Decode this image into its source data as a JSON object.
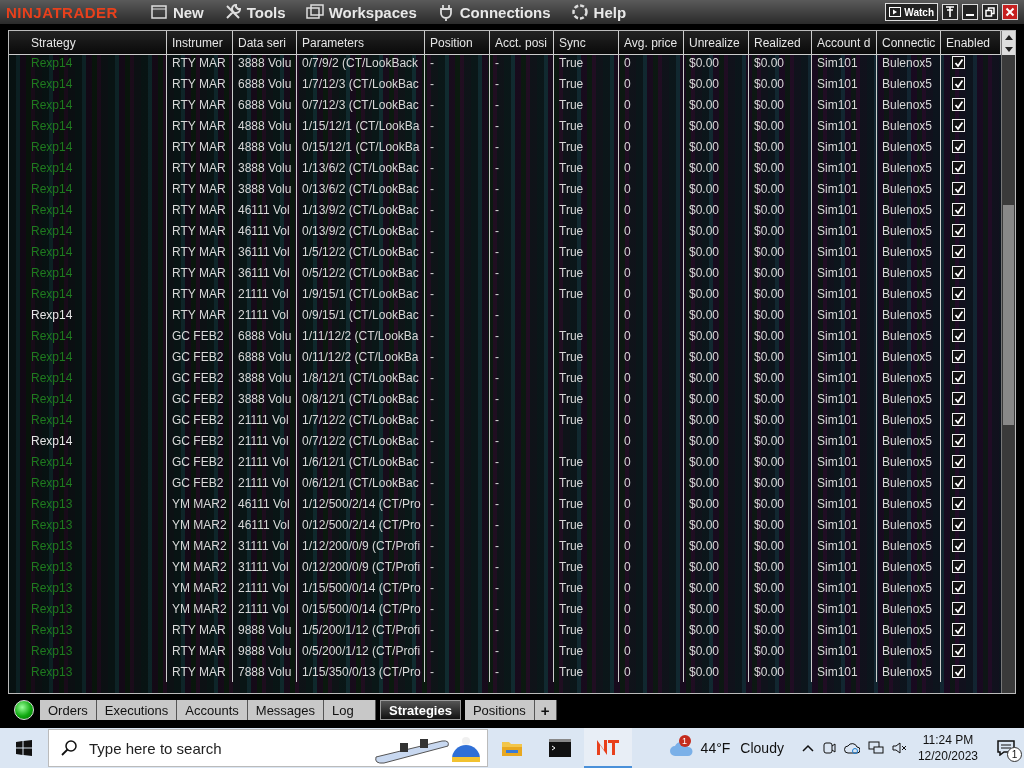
{
  "title_bar": {
    "logo": "NINJATRADER",
    "menu": [
      "New",
      "Tools",
      "Workspaces",
      "Connections",
      "Help"
    ],
    "watch_button": "Watch"
  },
  "table": {
    "columns": [
      "Strategy",
      "Instrumer",
      "Data seri",
      "Parameters",
      "Position",
      "Acct. posi",
      "Sync",
      "Avg. price",
      "Unrealize",
      "Realized",
      "Account d",
      "Connectic",
      "Enabled"
    ],
    "rows": [
      {
        "strategy": "Rexp14",
        "color": "#1f7a1f",
        "instrument": "RTY MAR",
        "data_series": "3888 Volu",
        "parameters": "0/7/9/2 (CT/LookBack",
        "position": "-",
        "acct_position": "-",
        "sync": "True",
        "avg_price": "0",
        "unrealized": "$0.00",
        "realized": "$0.00",
        "account": "Sim101",
        "connection": "Bulenox5",
        "enabled": true
      },
      {
        "strategy": "Rexp14",
        "color": "#1f7a1f",
        "instrument": "RTY MAR",
        "data_series": "6888 Volu",
        "parameters": "1/7/12/3 (CT/LookBac",
        "position": "-",
        "acct_position": "-",
        "sync": "True",
        "avg_price": "0",
        "unrealized": "$0.00",
        "realized": "$0.00",
        "account": "Sim101",
        "connection": "Bulenox5",
        "enabled": true
      },
      {
        "strategy": "Rexp14",
        "color": "#1f7a1f",
        "instrument": "RTY MAR",
        "data_series": "6888 Volu",
        "parameters": "0/7/12/3 (CT/LookBac",
        "position": "-",
        "acct_position": "-",
        "sync": "True",
        "avg_price": "0",
        "unrealized": "$0.00",
        "realized": "$0.00",
        "account": "Sim101",
        "connection": "Bulenox5",
        "enabled": true
      },
      {
        "strategy": "Rexp14",
        "color": "#1f7a1f",
        "instrument": "RTY MAR",
        "data_series": "4888 Volu",
        "parameters": "1/15/12/1 (CT/LookBa",
        "position": "-",
        "acct_position": "-",
        "sync": "True",
        "avg_price": "0",
        "unrealized": "$0.00",
        "realized": "$0.00",
        "account": "Sim101",
        "connection": "Bulenox5",
        "enabled": true
      },
      {
        "strategy": "Rexp14",
        "color": "#1f7a1f",
        "instrument": "RTY MAR",
        "data_series": "4888 Volu",
        "parameters": "0/15/12/1 (CT/LookBa",
        "position": "-",
        "acct_position": "-",
        "sync": "True",
        "avg_price": "0",
        "unrealized": "$0.00",
        "realized": "$0.00",
        "account": "Sim101",
        "connection": "Bulenox5",
        "enabled": true
      },
      {
        "strategy": "Rexp14",
        "color": "#1f7a1f",
        "instrument": "RTY MAR",
        "data_series": "3888 Volu",
        "parameters": "1/13/6/2 (CT/LookBac",
        "position": "-",
        "acct_position": "-",
        "sync": "True",
        "avg_price": "0",
        "unrealized": "$0.00",
        "realized": "$0.00",
        "account": "Sim101",
        "connection": "Bulenox5",
        "enabled": true
      },
      {
        "strategy": "Rexp14",
        "color": "#1f7a1f",
        "instrument": "RTY MAR",
        "data_series": "3888 Volu",
        "parameters": "0/13/6/2 (CT/LookBac",
        "position": "-",
        "acct_position": "-",
        "sync": "True",
        "avg_price": "0",
        "unrealized": "$0.00",
        "realized": "$0.00",
        "account": "Sim101",
        "connection": "Bulenox5",
        "enabled": true
      },
      {
        "strategy": "Rexp14",
        "color": "#1f7a1f",
        "instrument": "RTY MAR",
        "data_series": "46111 Vol",
        "parameters": "1/13/9/2 (CT/LookBac",
        "position": "-",
        "acct_position": "-",
        "sync": "True",
        "avg_price": "0",
        "unrealized": "$0.00",
        "realized": "$0.00",
        "account": "Sim101",
        "connection": "Bulenox5",
        "enabled": true
      },
      {
        "strategy": "Rexp14",
        "color": "#1f7a1f",
        "instrument": "RTY MAR",
        "data_series": "46111 Vol",
        "parameters": "0/13/9/2 (CT/LookBac",
        "position": "-",
        "acct_position": "-",
        "sync": "True",
        "avg_price": "0",
        "unrealized": "$0.00",
        "realized": "$0.00",
        "account": "Sim101",
        "connection": "Bulenox5",
        "enabled": true
      },
      {
        "strategy": "Rexp14",
        "color": "#1f7a1f",
        "instrument": "RTY MAR",
        "data_series": "36111 Vol",
        "parameters": "1/5/12/2 (CT/LookBac",
        "position": "-",
        "acct_position": "-",
        "sync": "True",
        "avg_price": "0",
        "unrealized": "$0.00",
        "realized": "$0.00",
        "account": "Sim101",
        "connection": "Bulenox5",
        "enabled": true
      },
      {
        "strategy": "Rexp14",
        "color": "#1f7a1f",
        "instrument": "RTY MAR",
        "data_series": "36111 Vol",
        "parameters": "0/5/12/2 (CT/LookBac",
        "position": "-",
        "acct_position": "-",
        "sync": "True",
        "avg_price": "0",
        "unrealized": "$0.00",
        "realized": "$0.00",
        "account": "Sim101",
        "connection": "Bulenox5",
        "enabled": true
      },
      {
        "strategy": "Rexp14",
        "color": "#1f7a1f",
        "instrument": "RTY MAR",
        "data_series": "21111 Vol",
        "parameters": "1/9/15/1 (CT/LookBac",
        "position": "-",
        "acct_position": "-",
        "sync": "True",
        "avg_price": "0",
        "unrealized": "$0.00",
        "realized": "$0.00",
        "account": "Sim101",
        "connection": "Bulenox5",
        "enabled": true
      },
      {
        "strategy": "Rexp14",
        "color": "#e6e6e6",
        "instrument": "RTY MAR",
        "data_series": "21111 Vol",
        "parameters": "0/9/15/1 (CT/LookBac",
        "position": "-",
        "acct_position": "-",
        "avg_price": "0",
        "unrealized": "$0.00",
        "realized": "$0.00",
        "account": "Sim101",
        "connection": "Bulenox5",
        "enabled": true
      },
      {
        "strategy": "Rexp14",
        "color": "#1f7a1f",
        "instrument": "GC FEB2",
        "data_series": "6888 Volu",
        "parameters": "1/11/12/2 (CT/LookBa",
        "position": "-",
        "acct_position": "-",
        "sync": "True",
        "avg_price": "0",
        "unrealized": "$0.00",
        "realized": "$0.00",
        "account": "Sim101",
        "connection": "Bulenox5",
        "enabled": true
      },
      {
        "strategy": "Rexp14",
        "color": "#1f7a1f",
        "instrument": "GC FEB2",
        "data_series": "6888 Volu",
        "parameters": "0/11/12/2 (CT/LookBa",
        "position": "-",
        "acct_position": "-",
        "sync": "True",
        "avg_price": "0",
        "unrealized": "$0.00",
        "realized": "$0.00",
        "account": "Sim101",
        "connection": "Bulenox5",
        "enabled": true
      },
      {
        "strategy": "Rexp14",
        "color": "#1f7a1f",
        "instrument": "GC FEB2",
        "data_series": "3888 Volu",
        "parameters": "1/8/12/1 (CT/LookBac",
        "position": "-",
        "acct_position": "-",
        "sync": "True",
        "avg_price": "0",
        "unrealized": "$0.00",
        "realized": "$0.00",
        "account": "Sim101",
        "connection": "Bulenox5",
        "enabled": true
      },
      {
        "strategy": "Rexp14",
        "color": "#1f7a1f",
        "instrument": "GC FEB2",
        "data_series": "3888 Volu",
        "parameters": "0/8/12/1 (CT/LookBac",
        "position": "-",
        "acct_position": "-",
        "sync": "True",
        "avg_price": "0",
        "unrealized": "$0.00",
        "realized": "$0.00",
        "account": "Sim101",
        "connection": "Bulenox5",
        "enabled": true
      },
      {
        "strategy": "Rexp14",
        "color": "#1f7a1f",
        "instrument": "GC FEB2",
        "data_series": "21111 Vol",
        "parameters": "1/7/12/2 (CT/LookBac",
        "position": "-",
        "acct_position": "-",
        "sync": "True",
        "avg_price": "0",
        "unrealized": "$0.00",
        "realized": "$0.00",
        "account": "Sim101",
        "connection": "Bulenox5",
        "enabled": true
      },
      {
        "strategy": "Rexp14",
        "color": "#e6e6e6",
        "instrument": "GC FEB2",
        "data_series": "21111 Vol",
        "parameters": "0/7/12/2 (CT/LookBac",
        "position": "-",
        "acct_position": "-",
        "avg_price": "0",
        "unrealized": "$0.00",
        "realized": "$0.00",
        "account": "Sim101",
        "connection": "Bulenox5",
        "enabled": true
      },
      {
        "strategy": "Rexp14",
        "color": "#1f7a1f",
        "instrument": "GC FEB2",
        "data_series": "21111 Vol",
        "parameters": "1/6/12/1 (CT/LookBac",
        "position": "-",
        "acct_position": "-",
        "sync": "True",
        "avg_price": "0",
        "unrealized": "$0.00",
        "realized": "$0.00",
        "account": "Sim101",
        "connection": "Bulenox5",
        "enabled": true
      },
      {
        "strategy": "Rexp14",
        "color": "#1f7a1f",
        "instrument": "GC FEB2",
        "data_series": "21111 Vol",
        "parameters": "0/6/12/1 (CT/LookBac",
        "position": "-",
        "acct_position": "-",
        "sync": "True",
        "avg_price": "0",
        "unrealized": "$0.00",
        "realized": "$0.00",
        "account": "Sim101",
        "connection": "Bulenox5",
        "enabled": true
      },
      {
        "strategy": "Rexp13",
        "color": "#1f7a1f",
        "instrument": "YM MAR2",
        "data_series": "46111 Vol",
        "parameters": "1/12/500/2/14 (CT/Pro",
        "position": "-",
        "acct_position": "-",
        "sync": "True",
        "avg_price": "0",
        "unrealized": "$0.00",
        "realized": "$0.00",
        "account": "Sim101",
        "connection": "Bulenox5",
        "enabled": true
      },
      {
        "strategy": "Rexp13",
        "color": "#1f7a1f",
        "instrument": "YM MAR2",
        "data_series": "46111 Vol",
        "parameters": "0/12/500/2/14 (CT/Pro",
        "position": "-",
        "acct_position": "-",
        "sync": "True",
        "avg_price": "0",
        "unrealized": "$0.00",
        "realized": "$0.00",
        "account": "Sim101",
        "connection": "Bulenox5",
        "enabled": true
      },
      {
        "strategy": "Rexp13",
        "color": "#1f7a1f",
        "instrument": "YM MAR2",
        "data_series": "31111 Vol",
        "parameters": "1/12/200/0/9 (CT/Profi",
        "position": "-",
        "acct_position": "-",
        "sync": "True",
        "avg_price": "0",
        "unrealized": "$0.00",
        "realized": "$0.00",
        "account": "Sim101",
        "connection": "Bulenox5",
        "enabled": true
      },
      {
        "strategy": "Rexp13",
        "color": "#1f7a1f",
        "instrument": "YM MAR2",
        "data_series": "31111 Vol",
        "parameters": "0/12/200/0/9 (CT/Profi",
        "position": "-",
        "acct_position": "-",
        "sync": "True",
        "avg_price": "0",
        "unrealized": "$0.00",
        "realized": "$0.00",
        "account": "Sim101",
        "connection": "Bulenox5",
        "enabled": true
      },
      {
        "strategy": "Rexp13",
        "color": "#1f7a1f",
        "instrument": "YM MAR2",
        "data_series": "21111 Vol",
        "parameters": "1/15/500/0/14 (CT/Pro",
        "position": "-",
        "acct_position": "-",
        "sync": "True",
        "avg_price": "0",
        "unrealized": "$0.00",
        "realized": "$0.00",
        "account": "Sim101",
        "connection": "Bulenox5",
        "enabled": true
      },
      {
        "strategy": "Rexp13",
        "color": "#1f7a1f",
        "instrument": "YM MAR2",
        "data_series": "21111 Vol",
        "parameters": "0/15/500/0/14 (CT/Pro",
        "position": "-",
        "acct_position": "-",
        "sync": "True",
        "avg_price": "0",
        "unrealized": "$0.00",
        "realized": "$0.00",
        "account": "Sim101",
        "connection": "Bulenox5",
        "enabled": true
      },
      {
        "strategy": "Rexp13",
        "color": "#1f7a1f",
        "instrument": "RTY MAR",
        "data_series": "9888 Volu",
        "parameters": "1/5/200/1/12 (CT/Profi",
        "position": "-",
        "acct_position": "-",
        "sync": "True",
        "avg_price": "0",
        "unrealized": "$0.00",
        "realized": "$0.00",
        "account": "Sim101",
        "connection": "Bulenox5",
        "enabled": true
      },
      {
        "strategy": "Rexp13",
        "color": "#1f7a1f",
        "instrument": "RTY MAR",
        "data_series": "9888 Volu",
        "parameters": "0/5/200/1/12 (CT/Profi",
        "position": "-",
        "acct_position": "-",
        "sync": "True",
        "avg_price": "0",
        "unrealized": "$0.00",
        "realized": "$0.00",
        "account": "Sim101",
        "connection": "Bulenox5",
        "enabled": true
      },
      {
        "strategy": "Rexp13",
        "color": "#1f7a1f",
        "instrument": "RTY MAR",
        "data_series": "7888 Volu",
        "parameters": "1/15/350/0/13 (CT/Pro",
        "position": "-",
        "acct_position": "-",
        "sync": "True",
        "avg_price": "0",
        "unrealized": "$0.00",
        "realized": "$0.00",
        "account": "Sim101",
        "connection": "Bulenox5",
        "enabled": true
      }
    ]
  },
  "tabs": [
    {
      "label": "Orders",
      "selected": false
    },
    {
      "label": "Executions",
      "selected": false
    },
    {
      "label": "Accounts",
      "selected": false
    },
    {
      "label": "Messages",
      "selected": false
    },
    {
      "label": "Log",
      "selected": false
    },
    {
      "label": "Strategies",
      "selected": true
    },
    {
      "label": "Positions",
      "selected": false
    },
    {
      "label": "+",
      "selected": false
    }
  ],
  "taskbar": {
    "search_placeholder": "Type here to search",
    "weather_badge": "1",
    "temperature": "44°F",
    "weather": "Cloudy",
    "time": "11:24 PM",
    "date": "12/20/2023",
    "notification_badge": "1"
  }
}
